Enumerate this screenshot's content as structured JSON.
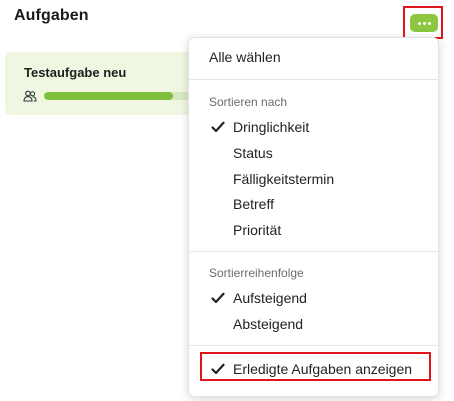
{
  "header": {
    "title": "Aufgaben",
    "more_button_icon": "ellipsis-icon",
    "accent_color": "#8dc63f"
  },
  "task_card": {
    "title": "Testaufgabe neu",
    "assignees_icon": "users-icon",
    "progress": 0.8,
    "background_color": "#eff7e2"
  },
  "menu": {
    "select_all": "Alle wählen",
    "sort_by": {
      "title": "Sortieren nach",
      "options": [
        {
          "label": "Dringlichkeit",
          "checked": true
        },
        {
          "label": "Status",
          "checked": false
        },
        {
          "label": "Fälligkeitstermin",
          "checked": false
        },
        {
          "label": "Betreff",
          "checked": false
        },
        {
          "label": "Priorität",
          "checked": false
        }
      ]
    },
    "sort_order": {
      "title": "Sortierreihenfolge",
      "options": [
        {
          "label": "Aufsteigend",
          "checked": true
        },
        {
          "label": "Absteigend",
          "checked": false
        }
      ]
    },
    "show_completed": {
      "label": "Erledigte Aufgaben anzeigen",
      "checked": true
    }
  },
  "highlight_color": "#e0141b"
}
